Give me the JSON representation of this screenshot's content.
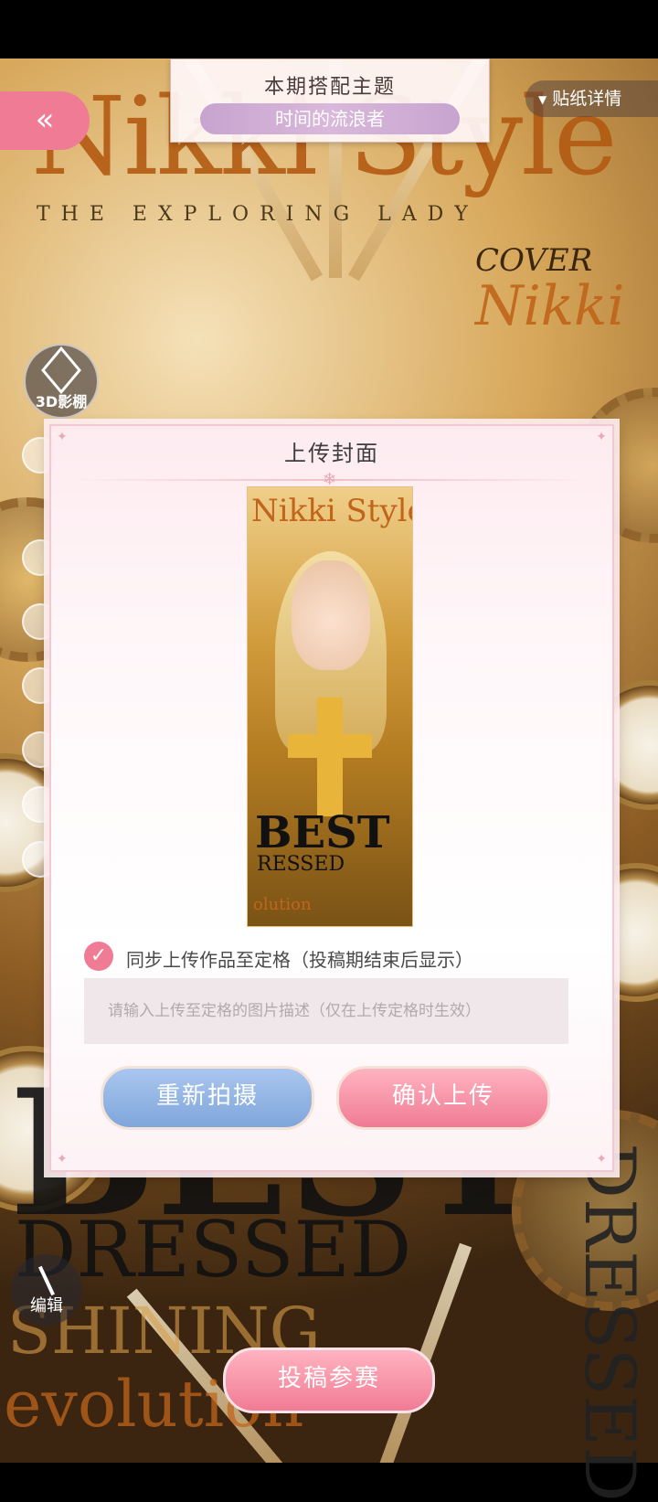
{
  "background": {
    "masthead": "Nikki Style",
    "subtitle": "THE EXPLORING LADY",
    "cover_label": "COVER",
    "cover_name": "Nikki",
    "best": "BEST",
    "dressed": "DRESSED",
    "shining": "SHINING",
    "evolution": "evolution",
    "vertical": "DRESSED"
  },
  "theme": {
    "title": "本期搭配主题",
    "name": "时间的流浪者"
  },
  "top_controls": {
    "back_icon": "double-chevron-left-icon",
    "sticker_label": "贴纸详情"
  },
  "left_controls": {
    "studio_label": "3D影棚",
    "edit_label": "编辑"
  },
  "bottom": {
    "submit_label": "投稿参赛"
  },
  "dialog": {
    "title": "上传封面",
    "preview": {
      "masthead": "Nikki Style",
      "best": "BEST",
      "dressed": "RESSED",
      "evolution": "olution"
    },
    "sync_checked": true,
    "sync_label": "同步上传作品至定格（投稿期结束后显示）",
    "description_placeholder": "请输入上传至定格的图片描述（仅在上传定格时生效）",
    "description_value": "",
    "retake_label": "重新拍摄",
    "confirm_label": "确认上传"
  },
  "colors": {
    "accent_pink": "#f07b95",
    "accent_blue": "#7fa6da",
    "theme_purple": "#c7a4cf"
  }
}
